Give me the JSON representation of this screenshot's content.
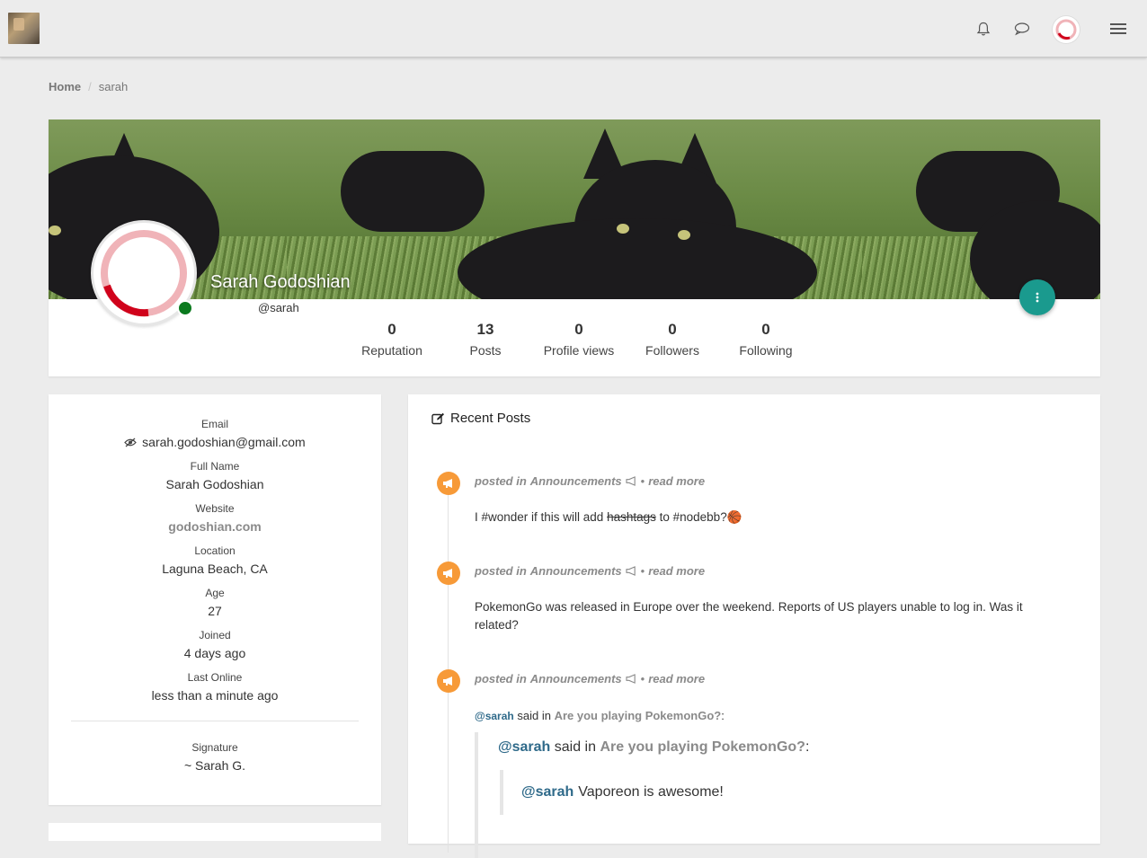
{
  "nav": {
    "logo_alt": "forum logo",
    "icons": [
      "bell-icon",
      "chat-icon",
      "user-avatar",
      "hamburger-menu-icon"
    ]
  },
  "breadcrumb": {
    "home": "Home",
    "separator": "/",
    "current": "sarah"
  },
  "profile": {
    "full_name": "Sarah Godoshian",
    "username": "@sarah",
    "online": true,
    "stats": [
      {
        "value": "0",
        "label": "Reputation"
      },
      {
        "value": "13",
        "label": "Posts"
      },
      {
        "value": "0",
        "label": "Profile views"
      },
      {
        "value": "0",
        "label": "Followers"
      },
      {
        "value": "0",
        "label": "Following"
      }
    ]
  },
  "info": {
    "email_label": "Email",
    "email_value": "sarah.godoshian@gmail.com",
    "fullname_label": "Full Name",
    "fullname_value": "Sarah Godoshian",
    "website_label": "Website",
    "website_value": "godoshian.com",
    "location_label": "Location",
    "location_value": "Laguna Beach, CA",
    "age_label": "Age",
    "age_value": "27",
    "joined_label": "Joined",
    "joined_value": "4 days ago",
    "last_online_label": "Last Online",
    "last_online_value": "less than a minute ago",
    "signature_label": "Signature",
    "signature_value": "~ Sarah G."
  },
  "posts": {
    "title": "Recent Posts",
    "posted_in": "posted in",
    "read_more": "read more",
    "bullet": "•",
    "items": [
      {
        "category": "Announcements",
        "text_parts": [
          "I #wonder if this will add ",
          "hashtags",
          " to #nodebb?"
        ],
        "emoji": "🏀"
      },
      {
        "category": "Announcements",
        "text": "PokemonGo was released in Europe over the weekend. Reports of US players unable to log in. Was it related?"
      },
      {
        "category": "Announcements",
        "quote_mention": "@sarah",
        "said_in": "said in",
        "quote_topic": "Are you playing PokemonGo?",
        "colon": ":",
        "inner_quote_text": "Vaporeon is awesome!"
      }
    ]
  },
  "colors": {
    "accent_fab": "#1a9a8e",
    "post_icon": "#f79a38",
    "online_dot": "#0b7a1e",
    "avatar_ring": "#d0021b"
  }
}
